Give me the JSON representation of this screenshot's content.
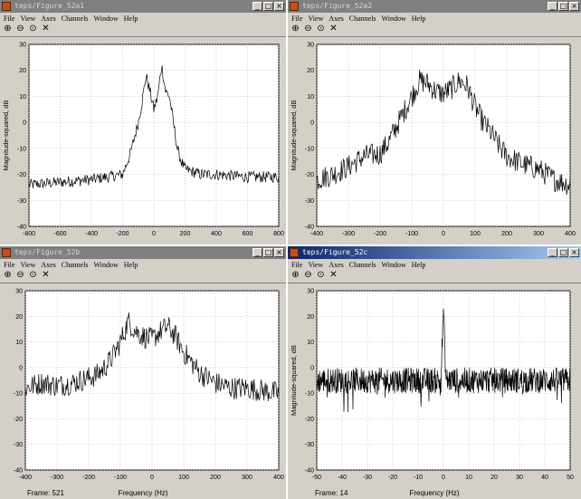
{
  "windows": [
    {
      "title": "teps/Figure_52a1",
      "active": false,
      "menu": [
        "File",
        "View",
        "Axes",
        "Channels",
        "Window",
        "Help"
      ],
      "ylabel": "Magnitude-squared, dB",
      "xlabel": "",
      "frame": "",
      "chart_data": {
        "type": "line",
        "xlim": [
          -800,
          800
        ],
        "ylim": [
          -40,
          30
        ],
        "xticks": [
          -800,
          -600,
          -400,
          -200,
          0,
          200,
          400,
          600,
          800
        ],
        "yticks": [
          30,
          20,
          10,
          0,
          -10,
          -20,
          -30,
          -40
        ],
        "grid": true,
        "x": [
          -800,
          -600,
          -400,
          -300,
          -200,
          -150,
          -100,
          -75,
          -50,
          -25,
          0,
          25,
          50,
          75,
          100,
          125,
          150,
          175,
          200,
          250,
          300,
          400,
          600,
          800
        ],
        "y": [
          -24,
          -23,
          -22,
          -21,
          -20,
          -12,
          0,
          8,
          18,
          12,
          5,
          10,
          22,
          12,
          10,
          0,
          -10,
          -15,
          -18,
          -19,
          -20,
          -20,
          -21,
          -21
        ]
      }
    },
    {
      "title": "teps/Figure_52a2",
      "active": false,
      "menu": [
        "File",
        "View",
        "Axes",
        "Channels",
        "Window",
        "Help"
      ],
      "ylabel": "Magnitude-squared, dB",
      "xlabel": "",
      "frame": "",
      "chart_data": {
        "type": "line",
        "xlim": [
          -400,
          400
        ],
        "ylim": [
          -40,
          30
        ],
        "xticks": [
          -400,
          -300,
          -200,
          -100,
          0,
          100,
          200,
          300,
          400
        ],
        "yticks": [
          30,
          20,
          10,
          0,
          -10,
          -20,
          -30,
          -40
        ],
        "grid": true,
        "x": [
          -400,
          -350,
          -300,
          -250,
          -200,
          -175,
          -150,
          -125,
          -100,
          -75,
          -50,
          -25,
          0,
          25,
          50,
          75,
          100,
          125,
          150,
          175,
          200,
          250,
          300,
          350,
          400
        ],
        "y": [
          -22,
          -20,
          -17,
          -13,
          -12,
          -8,
          -2,
          4,
          10,
          16,
          15,
          12,
          11,
          13,
          16,
          14,
          6,
          0,
          -4,
          -9,
          -13,
          -16,
          -18,
          -22,
          -24
        ]
      }
    },
    {
      "title": "teps/Figure_52b",
      "active": false,
      "menu": [
        "File",
        "View",
        "Axes",
        "Channels",
        "Window",
        "Help"
      ],
      "ylabel": "",
      "xlabel": "Frequency (Hz)",
      "frame": "Frame: 521",
      "chart_data": {
        "type": "line",
        "xlim": [
          -400,
          400
        ],
        "ylim": [
          -40,
          30
        ],
        "xticks": [
          -400,
          -300,
          -200,
          -100,
          0,
          100,
          200,
          300,
          400
        ],
        "yticks": [
          30,
          20,
          10,
          0,
          -10,
          -20,
          -30,
          -40
        ],
        "grid": true,
        "x": [
          -400,
          -350,
          -300,
          -250,
          -200,
          -175,
          -150,
          -125,
          -100,
          -75,
          -50,
          -25,
          0,
          25,
          50,
          75,
          100,
          125,
          150,
          175,
          200,
          250,
          300,
          350,
          400
        ],
        "y": [
          -8,
          -6,
          -7,
          -6,
          -4,
          -3,
          0,
          4,
          10,
          18,
          14,
          12,
          11,
          14,
          16,
          12,
          6,
          2,
          -2,
          -4,
          -6,
          -8,
          -8,
          -9,
          -10
        ]
      }
    },
    {
      "title": "teps/Figure_52c",
      "active": true,
      "menu": [
        "File",
        "View",
        "Axes",
        "Channels",
        "Window",
        "Help"
      ],
      "ylabel": "Magnitude-squared, dB",
      "xlabel": "Frequency (Hz)",
      "frame": "Frame: 14",
      "chart_data": {
        "type": "line",
        "xlim": [
          -50,
          50
        ],
        "ylim": [
          -40,
          30
        ],
        "xticks": [
          -50,
          -40,
          -30,
          -20,
          -10,
          0,
          10,
          20,
          30,
          40,
          50
        ],
        "yticks": [
          30,
          20,
          10,
          0,
          -10,
          -20,
          -30,
          -40
        ],
        "grid": true,
        "x": [
          -50,
          -40,
          -30,
          -20,
          -10,
          -1,
          0,
          1,
          10,
          20,
          30,
          40,
          50
        ],
        "y": [
          -5,
          -5,
          -5,
          -5,
          -5,
          -5,
          23,
          -5,
          -5,
          -5,
          -5,
          -5,
          -5
        ]
      }
    }
  ]
}
